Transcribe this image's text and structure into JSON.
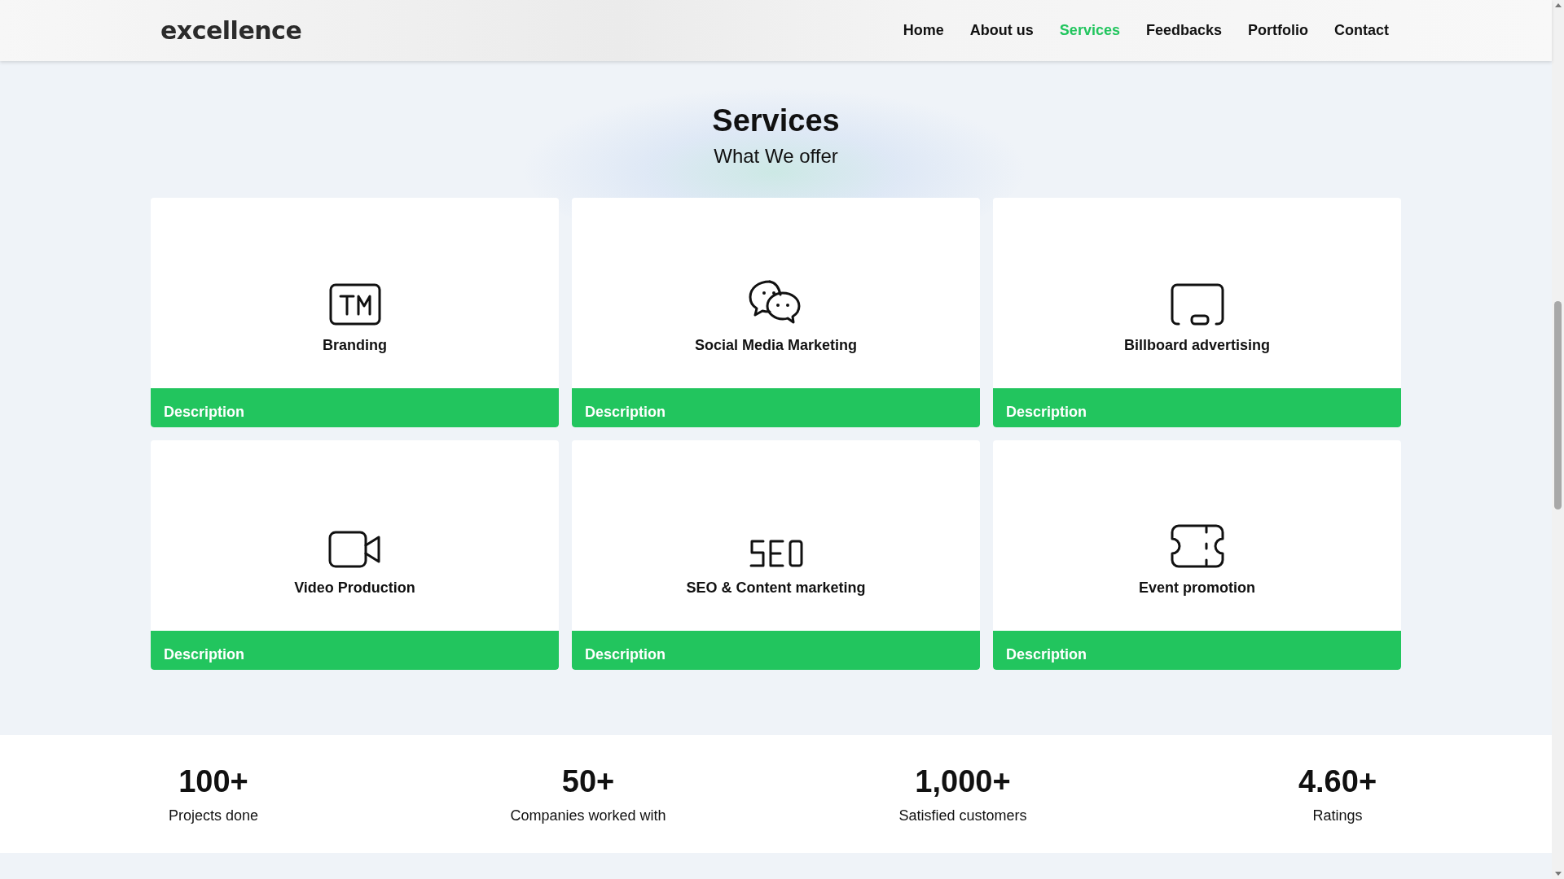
{
  "header": {
    "logo": "excellence",
    "nav": [
      {
        "label": "Home",
        "selected": false
      },
      {
        "label": "About us",
        "selected": false
      },
      {
        "label": "Services",
        "selected": true
      },
      {
        "label": "Feedbacks",
        "selected": false
      },
      {
        "label": "Portfolio",
        "selected": false
      },
      {
        "label": "Contact",
        "selected": false
      }
    ]
  },
  "section": {
    "title": "Services",
    "subtitle": "What We offer"
  },
  "services": [
    {
      "kind": "trademark",
      "name": "Branding",
      "footer": "Description"
    },
    {
      "kind": "chat",
      "name": "Social Media Marketing",
      "footer": "Description"
    },
    {
      "kind": "billboard",
      "name": "Billboard advertising",
      "footer": "Description"
    },
    {
      "kind": "video",
      "name": "Video Production",
      "footer": "Description"
    },
    {
      "kind": "seo",
      "name": "SEO & Content marketing",
      "footer": "Description"
    },
    {
      "kind": "ticket",
      "name": "Event promotion",
      "footer": "Description"
    }
  ],
  "stats": [
    {
      "value": "100+",
      "label": "Projects done"
    },
    {
      "value": "50+",
      "label": "Companies worked with"
    },
    {
      "value": "1,000+",
      "label": "Satisfied customers"
    },
    {
      "value": "4.60+",
      "label": "Ratings"
    }
  ]
}
